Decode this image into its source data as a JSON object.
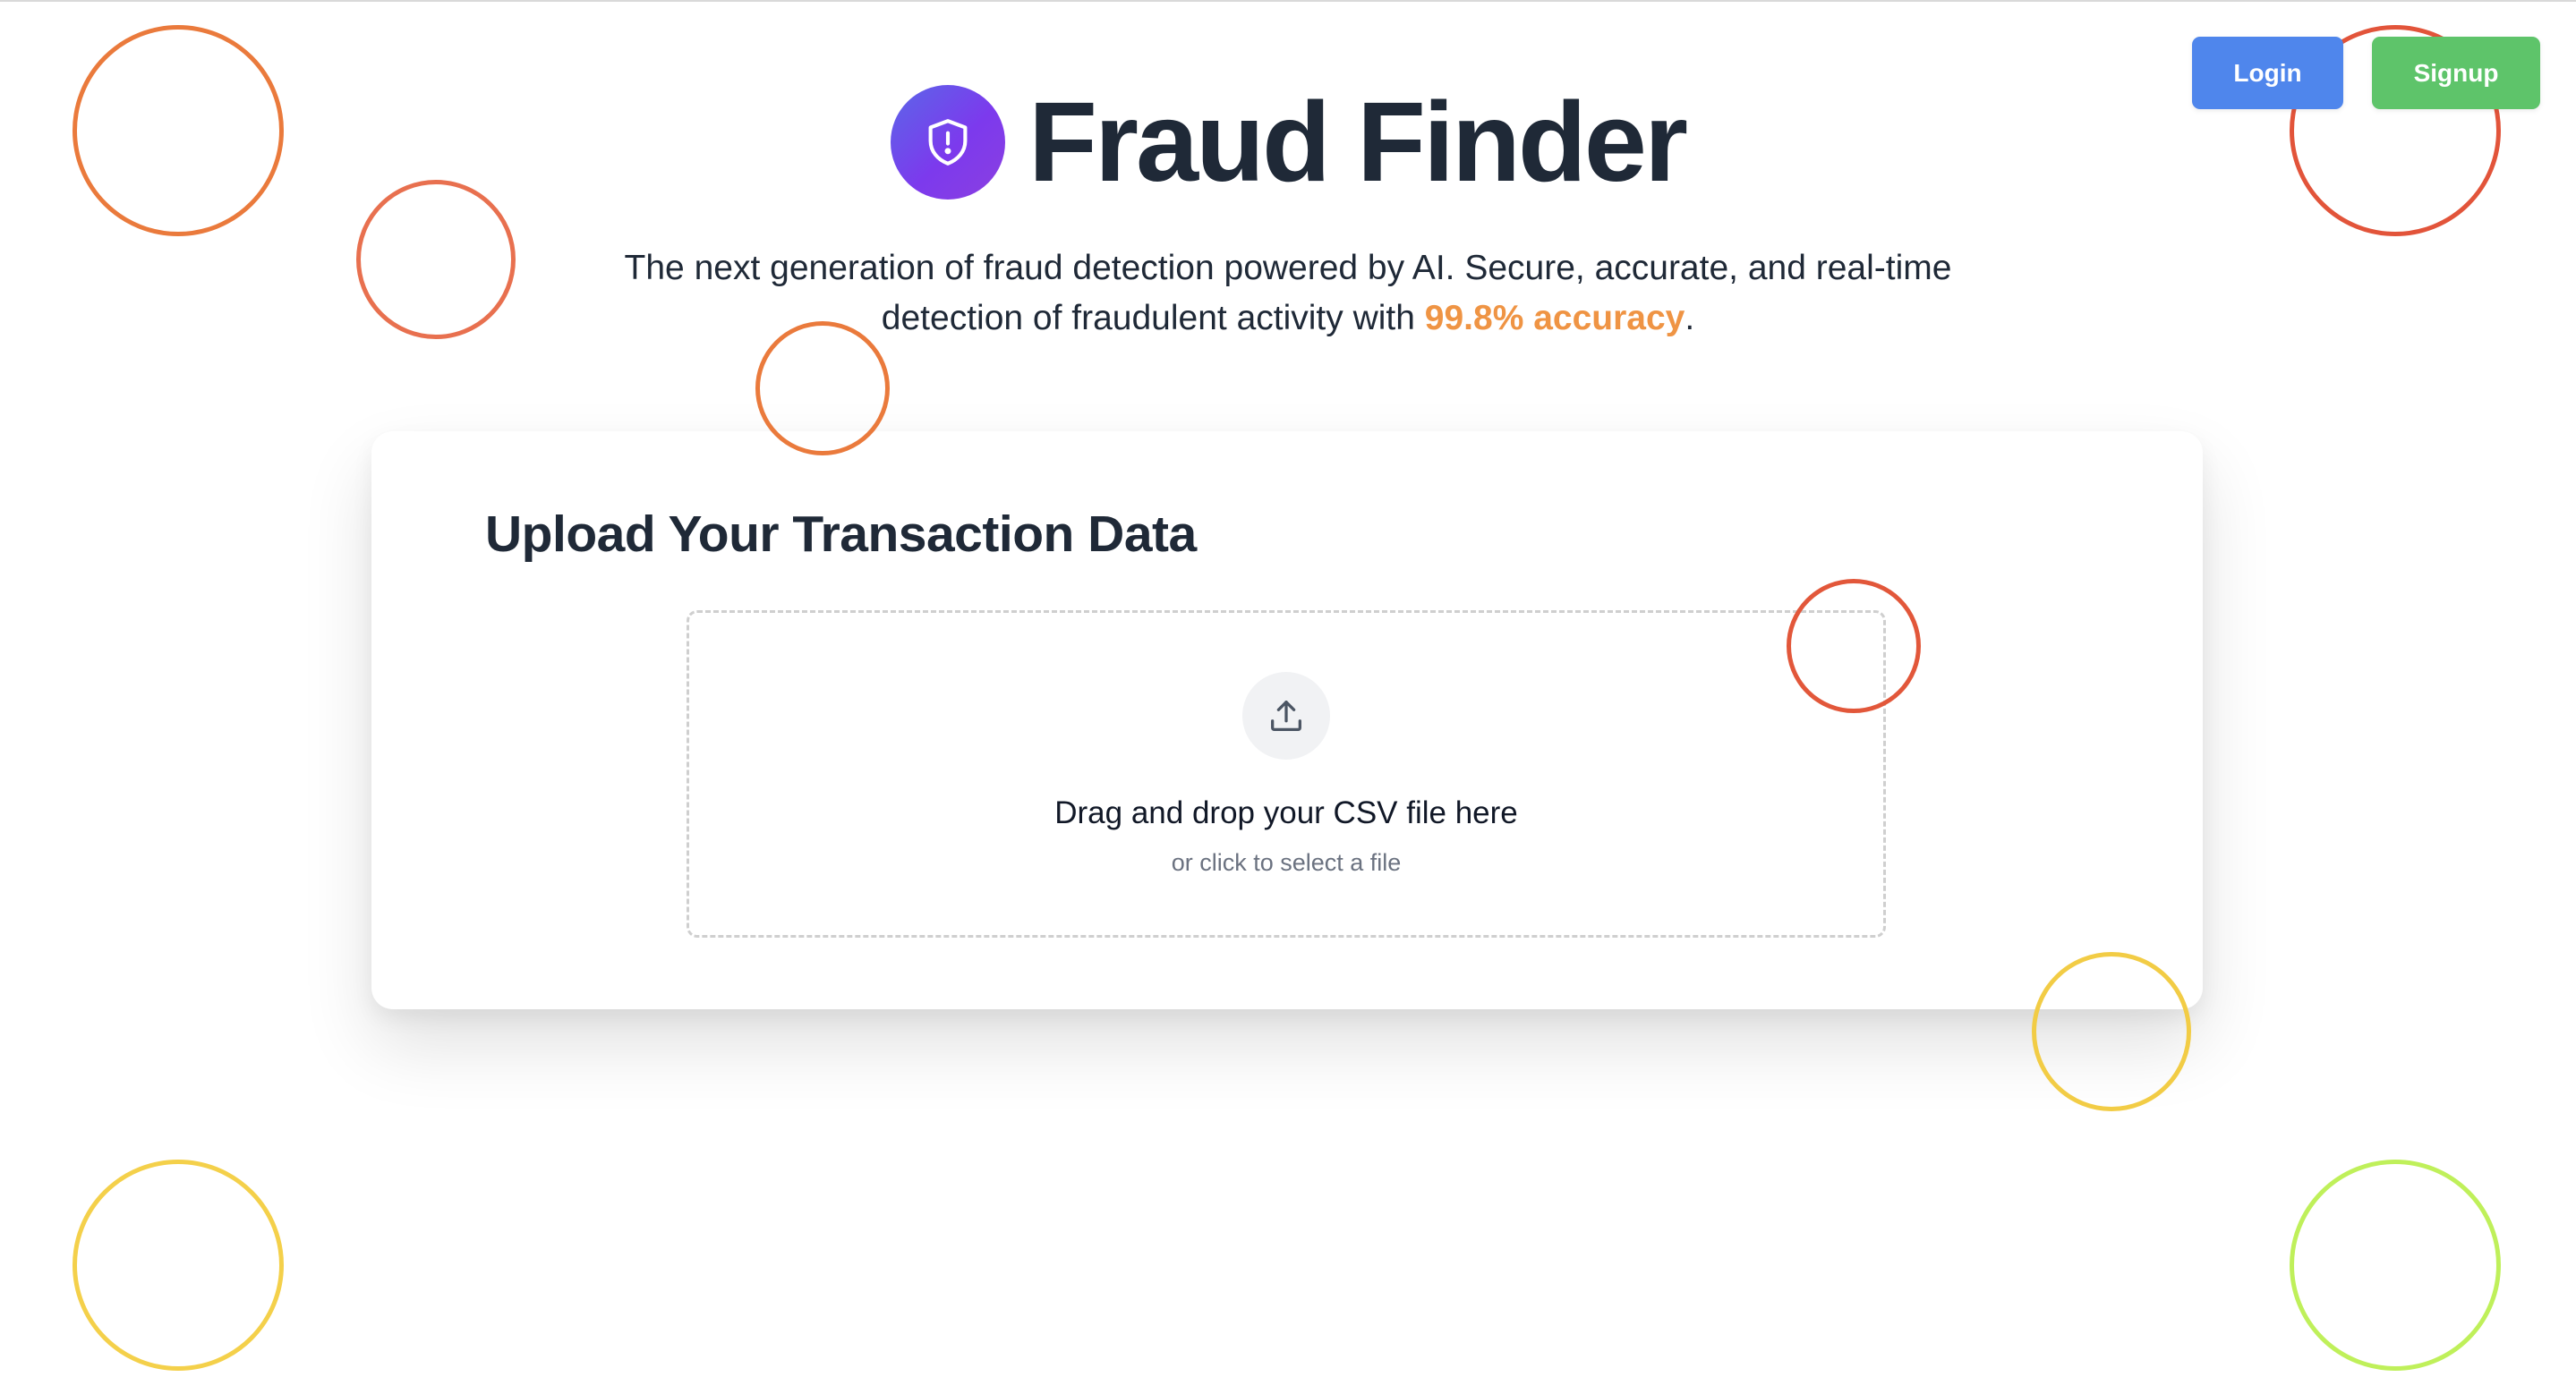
{
  "app": {
    "title": "Fraud Finder",
    "logo_icon": "shield-alert-icon",
    "brand_gradient": [
      "#5b67e8",
      "#7c3aed"
    ]
  },
  "auth": {
    "login_label": "Login",
    "signup_label": "Signup",
    "login_color": "#4f86ec",
    "signup_color": "#5ec46a"
  },
  "hero": {
    "tagline_line1": "The next generation of fraud detection powered by AI. Secure, accurate, and real-time",
    "tagline_line2_prefix": "detection of fraudulent activity with ",
    "accuracy_text": "99.8% accuracy",
    "tagline_line2_suffix": ".",
    "accent_color": "#ef9444"
  },
  "upload": {
    "title": "Upload Your Transaction Data",
    "icon": "upload-icon",
    "drop_prompt": "Drag and drop your CSV file here",
    "drop_hint": "or click to select a file"
  },
  "decorations": {
    "circle_colors": [
      "#ea7a3c",
      "#e8704f",
      "#e2543a",
      "#f2cc45",
      "#bff05a"
    ]
  }
}
